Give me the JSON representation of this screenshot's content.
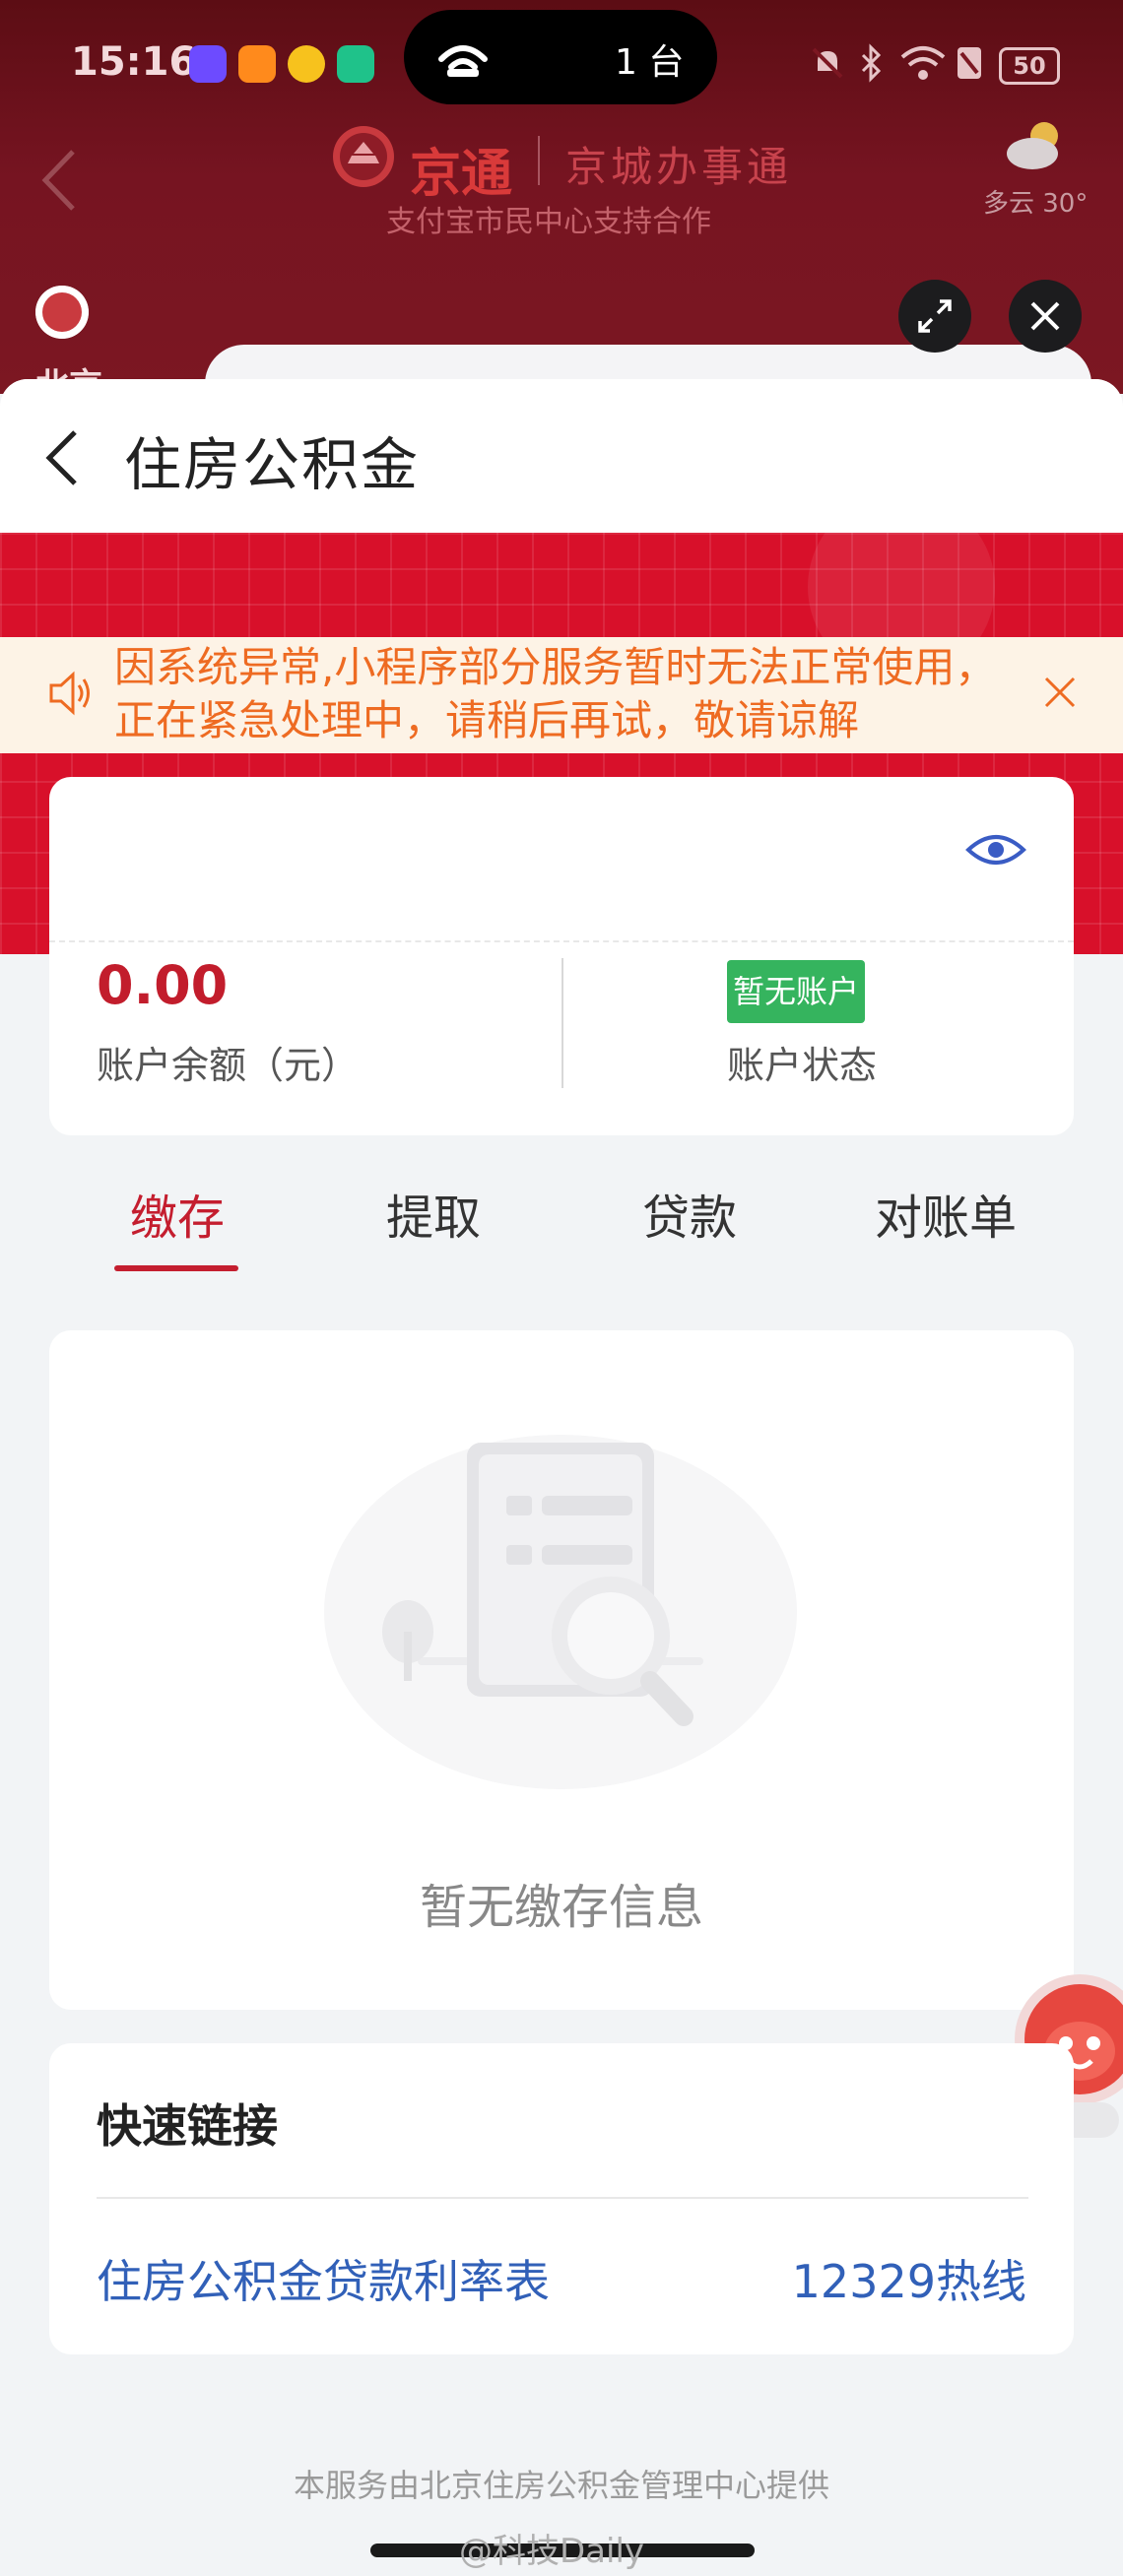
{
  "status_bar": {
    "time": "15:16",
    "island_count": "1 台",
    "battery": "50"
  },
  "host_page": {
    "logo_text": "京通",
    "logo_subtext": "京城办事通",
    "subtitle": "支付宝市民中心支持合作",
    "weather": "多云 30°",
    "city": "北京"
  },
  "mini_program": {
    "title": "住房公积金",
    "notice": "因系统异常,小程序部分服务暂时无法正常使用，正在紧急处理中，请稍后再试，敬请谅解",
    "account": {
      "balance_value": "0.00",
      "balance_label": "账户余额（元）",
      "status_badge": "暂无账户",
      "status_label": "账户状态"
    },
    "tabs": [
      {
        "label": "缴存",
        "active": true
      },
      {
        "label": "提取",
        "active": false
      },
      {
        "label": "贷款",
        "active": false
      },
      {
        "label": "对账单",
        "active": false
      }
    ],
    "empty_state": "暂无缴存信息",
    "quick_links": {
      "title": "快速链接",
      "items": [
        "住房公积金贷款利率表",
        "12329热线"
      ]
    },
    "footer": "本服务由北京住房公积金管理中心提供"
  },
  "watermark": "@科技Daily",
  "colors": {
    "brand_red": "#d8102a",
    "active_tab": "#c41e2f",
    "balance": "#c21d2c",
    "notice_text": "#ee6b22",
    "link": "#3160b8",
    "badge_green": "#35b45e"
  }
}
